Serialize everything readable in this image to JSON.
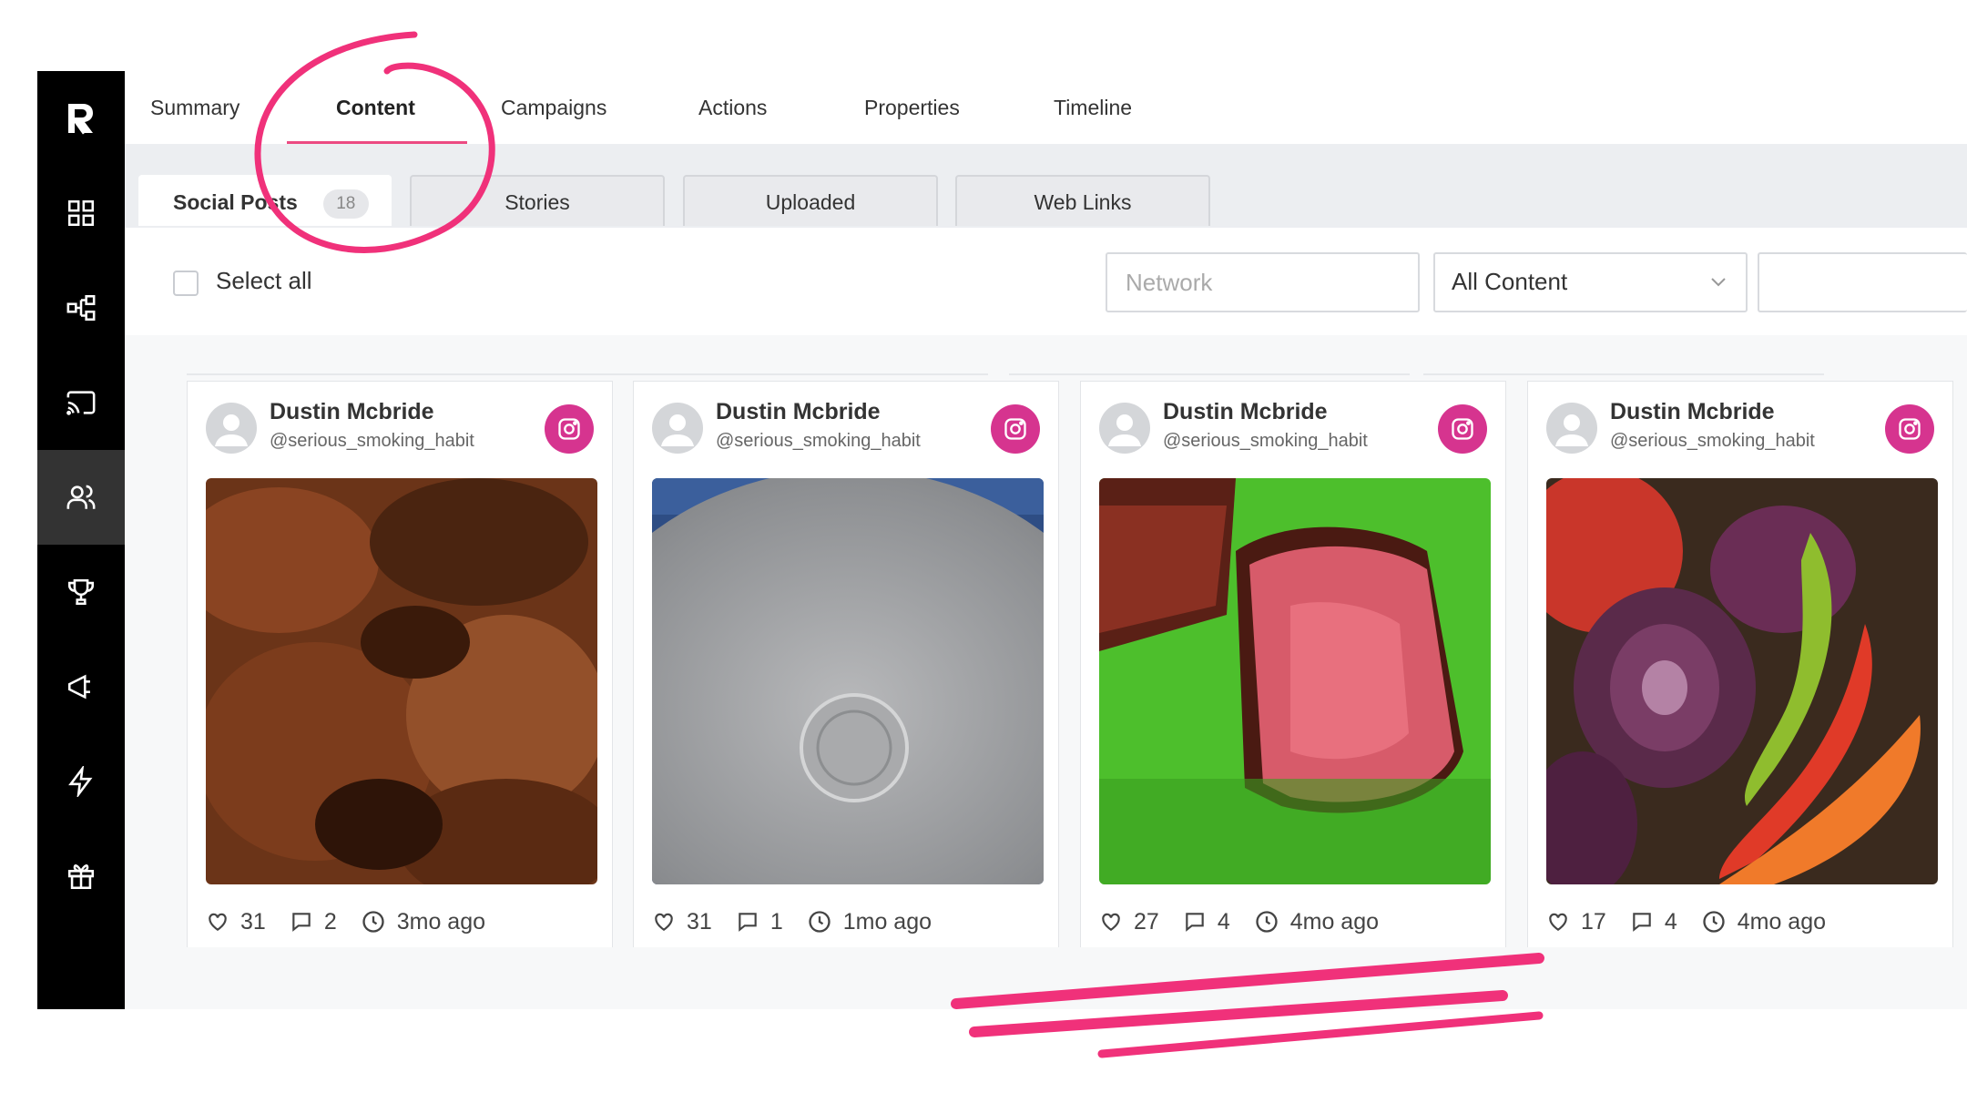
{
  "top_tabs": [
    "Summary",
    "Content",
    "Campaigns",
    "Actions",
    "Properties",
    "Timeline"
  ],
  "active_top_tab": "Content",
  "sub_tabs": {
    "social_posts": {
      "label": "Social Posts",
      "count": "18"
    },
    "stories": "Stories",
    "uploaded": "Uploaded",
    "web_links": "Web Links"
  },
  "filters": {
    "select_all": "Select all",
    "network_placeholder": "Network",
    "content_filter": "All Content"
  },
  "posts": [
    {
      "author": "Dustin Mcbride",
      "handle": "@serious_smoking_habit",
      "network": "instagram",
      "image": "smoked chicken thighs",
      "likes": "31",
      "comments": "2",
      "age": "3mo ago"
    },
    {
      "author": "Dustin Mcbride",
      "handle": "@serious_smoking_habit",
      "network": "instagram",
      "image": "engraved steel pan lid",
      "likes": "31",
      "comments": "1",
      "age": "1mo ago"
    },
    {
      "author": "Dustin Mcbride",
      "handle": "@serious_smoking_habit",
      "network": "instagram",
      "image": "sliced rare steak",
      "likes": "27",
      "comments": "4",
      "age": "4mo ago"
    },
    {
      "author": "Dustin Mcbride",
      "handle": "@serious_smoking_habit",
      "network": "instagram",
      "image": "grilled vegetables",
      "likes": "17",
      "comments": "4",
      "age": "4mo ago"
    }
  ],
  "colors": {
    "accent": "#ec4a82",
    "instagram": "#d6348f",
    "sidebar": "#000000",
    "annotation": "#f0317a"
  },
  "sidebar_icons": [
    "logo",
    "dashboard-icon",
    "workflow-icon",
    "cast-icon",
    "users-icon",
    "trophy-icon",
    "megaphone-icon",
    "lightning-icon",
    "gift-icon"
  ]
}
